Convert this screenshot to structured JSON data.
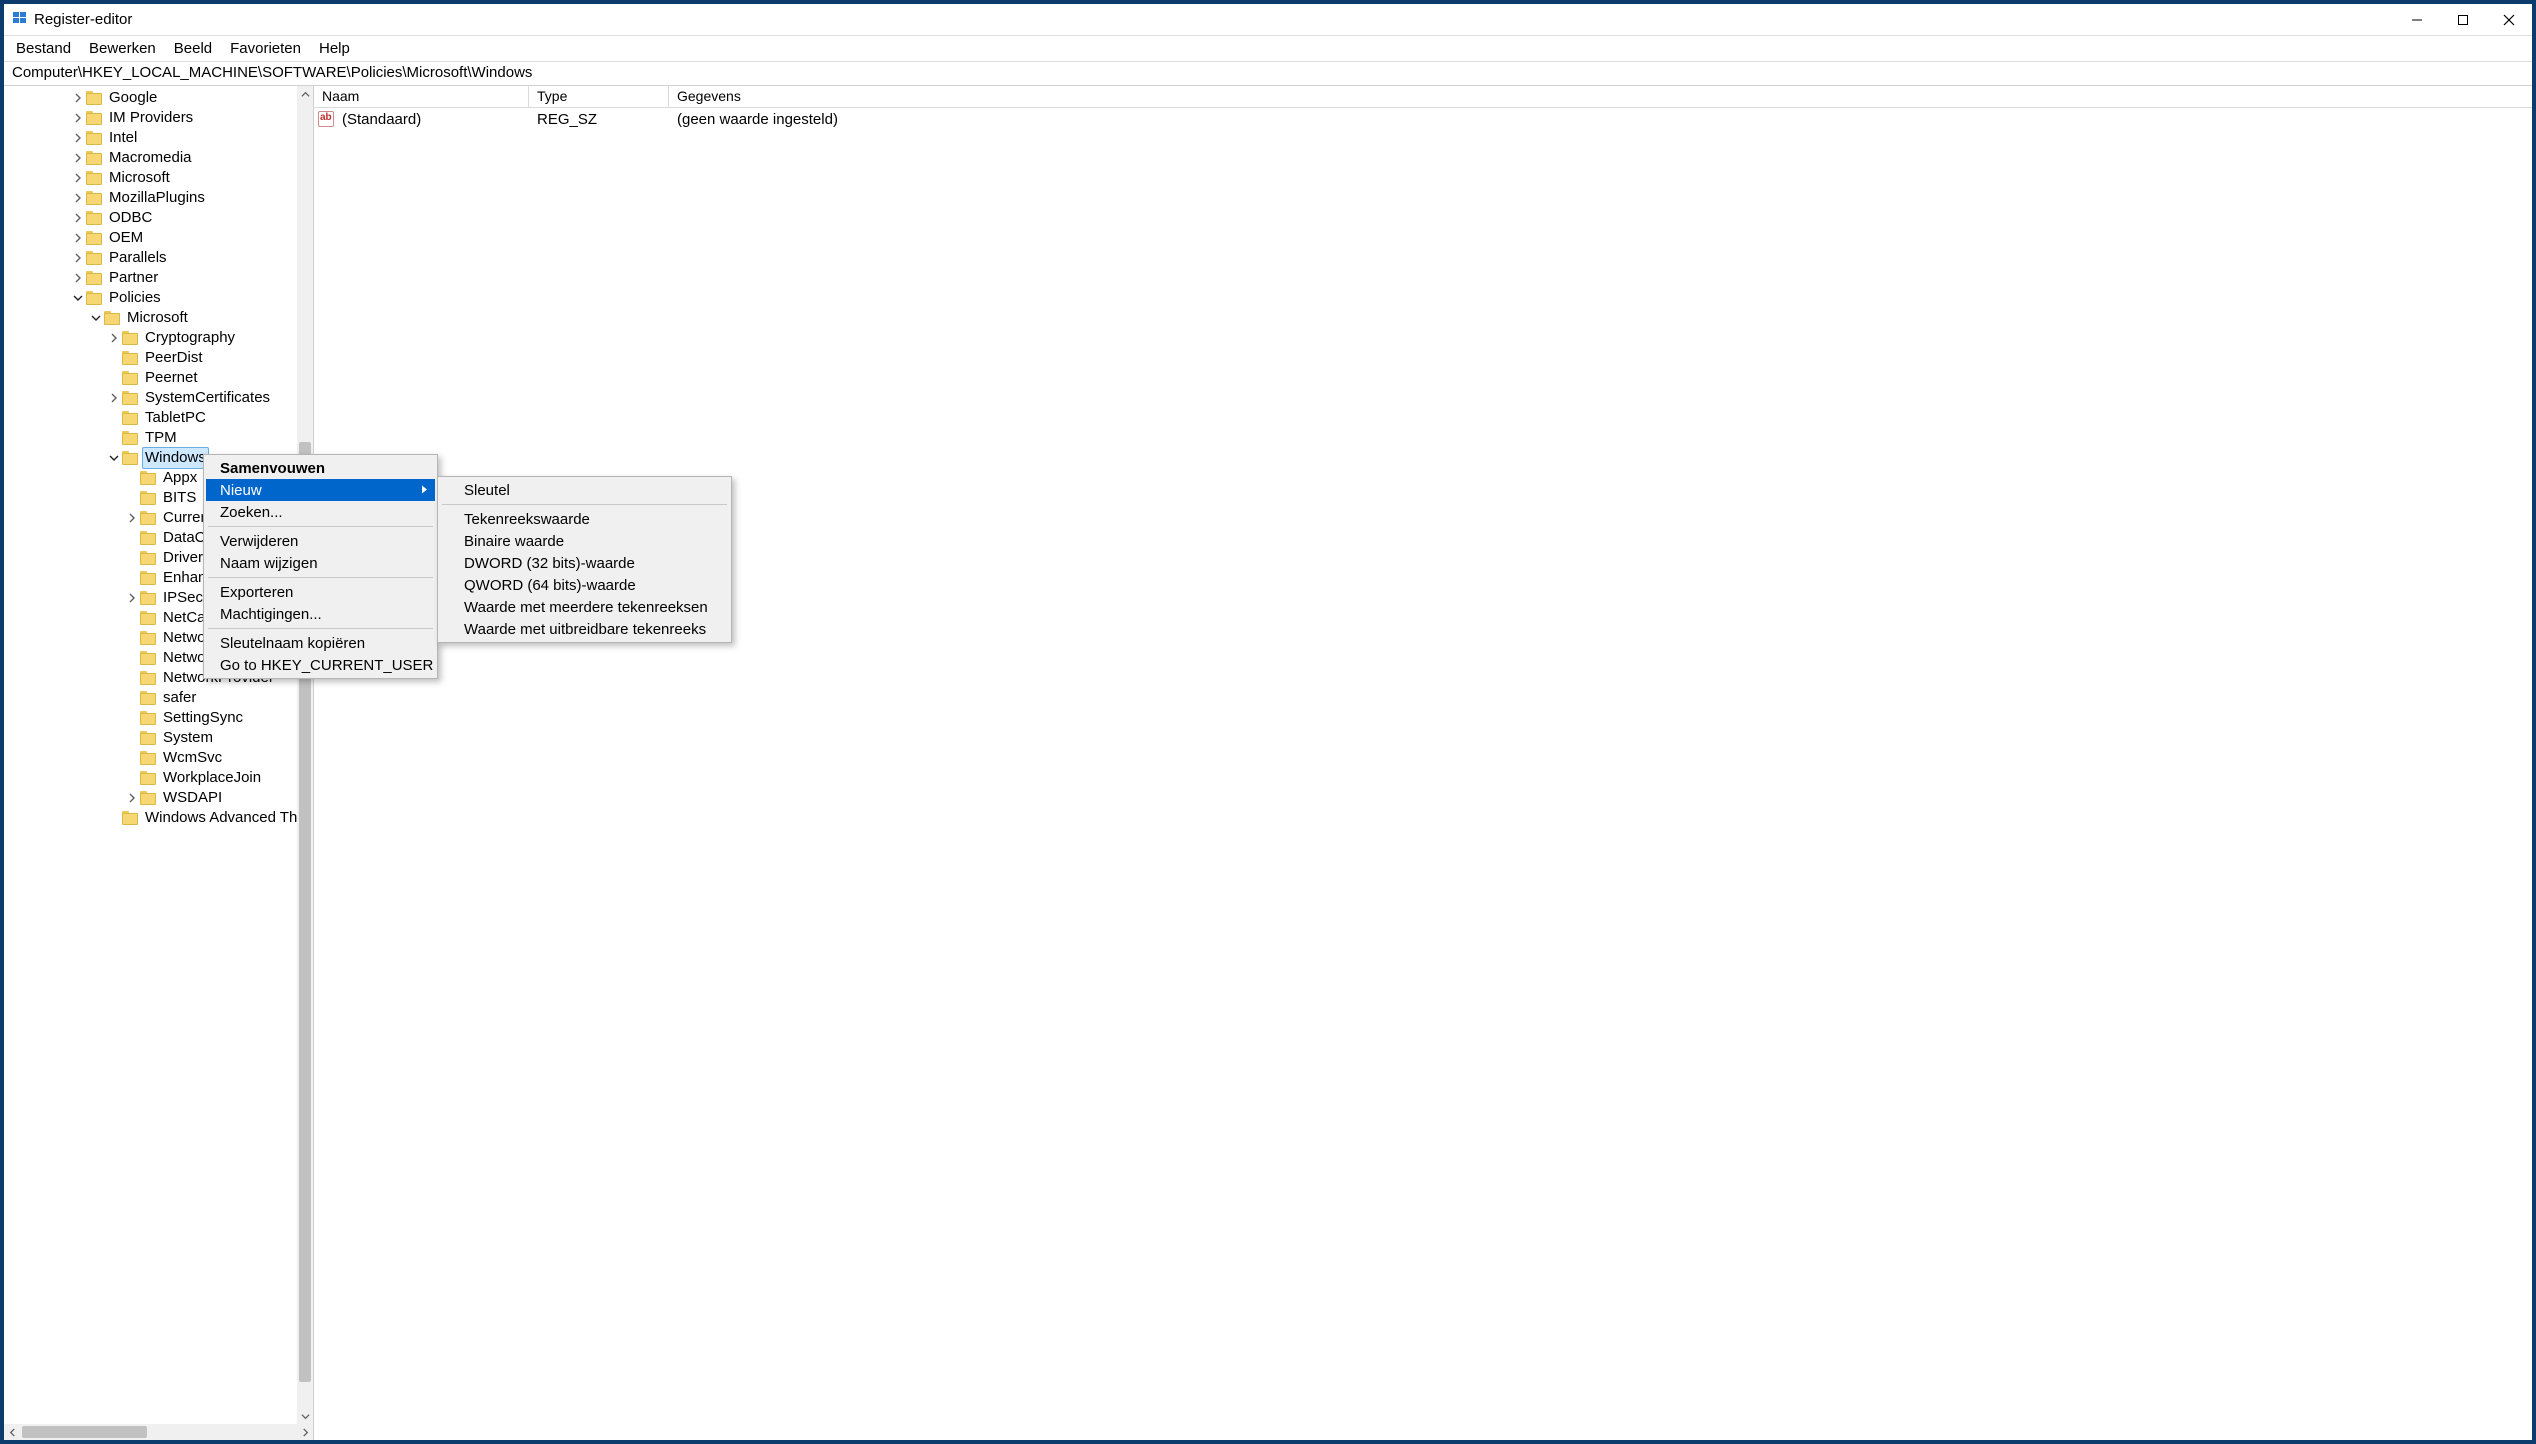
{
  "window": {
    "title": "Register-editor"
  },
  "menubar": {
    "items": [
      "Bestand",
      "Bewerken",
      "Beeld",
      "Favorieten",
      "Help"
    ]
  },
  "addressbar": {
    "path": "Computer\\HKEY_LOCAL_MACHINE\\SOFTWARE\\Policies\\Microsoft\\Windows"
  },
  "tree": {
    "nodes": [
      {
        "depth": 3,
        "chev": "right",
        "label": "Google"
      },
      {
        "depth": 3,
        "chev": "right",
        "label": "IM Providers"
      },
      {
        "depth": 3,
        "chev": "right",
        "label": "Intel"
      },
      {
        "depth": 3,
        "chev": "right",
        "label": "Macromedia"
      },
      {
        "depth": 3,
        "chev": "right",
        "label": "Microsoft"
      },
      {
        "depth": 3,
        "chev": "right",
        "label": "MozillaPlugins"
      },
      {
        "depth": 3,
        "chev": "right",
        "label": "ODBC"
      },
      {
        "depth": 3,
        "chev": "right",
        "label": "OEM"
      },
      {
        "depth": 3,
        "chev": "right",
        "label": "Parallels"
      },
      {
        "depth": 3,
        "chev": "right",
        "label": "Partner"
      },
      {
        "depth": 3,
        "chev": "down",
        "label": "Policies"
      },
      {
        "depth": 4,
        "chev": "down",
        "label": "Microsoft"
      },
      {
        "depth": 5,
        "chev": "right",
        "label": "Cryptography"
      },
      {
        "depth": 5,
        "chev": "none",
        "label": "PeerDist"
      },
      {
        "depth": 5,
        "chev": "none",
        "label": "Peernet"
      },
      {
        "depth": 5,
        "chev": "right",
        "label": "SystemCertificates"
      },
      {
        "depth": 5,
        "chev": "none",
        "label": "TabletPC"
      },
      {
        "depth": 5,
        "chev": "none",
        "label": "TPM"
      },
      {
        "depth": 5,
        "chev": "down",
        "label": "Windows",
        "selected": true
      },
      {
        "depth": 6,
        "chev": "none",
        "label": "Appx"
      },
      {
        "depth": 6,
        "chev": "none",
        "label": "BITS"
      },
      {
        "depth": 6,
        "chev": "right",
        "label": "CurrentVersion",
        "truncated": "Curren"
      },
      {
        "depth": 6,
        "chev": "none",
        "label": "DataCollection",
        "truncated": "DataC"
      },
      {
        "depth": 6,
        "chev": "none",
        "label": "DriverSearching",
        "truncated": "Driver"
      },
      {
        "depth": 6,
        "chev": "none",
        "label": "EnhancedStorageDevices",
        "truncated": "Enhan"
      },
      {
        "depth": 6,
        "chev": "right",
        "label": "IPSec"
      },
      {
        "depth": 6,
        "chev": "none",
        "label": "NetCache",
        "truncated": "NetCa"
      },
      {
        "depth": 6,
        "chev": "none",
        "label": "NetworkConnectivityStatusIndicator",
        "truncated": "Netwo"
      },
      {
        "depth": 6,
        "chev": "none",
        "label": "NetworkIsolation",
        "truncated": "Netwo"
      },
      {
        "depth": 6,
        "chev": "none",
        "label": "NetworkProvider",
        "truncated": "NetworkProvider"
      },
      {
        "depth": 6,
        "chev": "none",
        "label": "safer"
      },
      {
        "depth": 6,
        "chev": "none",
        "label": "SettingSync"
      },
      {
        "depth": 6,
        "chev": "none",
        "label": "System"
      },
      {
        "depth": 6,
        "chev": "none",
        "label": "WcmSvc"
      },
      {
        "depth": 6,
        "chev": "none",
        "label": "WorkplaceJoin"
      },
      {
        "depth": 6,
        "chev": "right",
        "label": "WSDAPI"
      },
      {
        "depth": 5,
        "chev": "none",
        "label": "Windows Advanced Threa"
      }
    ]
  },
  "values": {
    "columns": {
      "name": "Naam",
      "type": "Type",
      "data": "Gegevens"
    },
    "rows": [
      {
        "name": "(Standaard)",
        "type": "REG_SZ",
        "data": "(geen waarde ingesteld)"
      }
    ]
  },
  "context_menu": {
    "items": [
      {
        "label": "Samenvouwen",
        "bold": true
      },
      {
        "label": "Nieuw",
        "submenu": true,
        "hover": true
      },
      {
        "label": "Zoeken..."
      },
      {
        "sep": true
      },
      {
        "label": "Verwijderen"
      },
      {
        "label": "Naam wijzigen"
      },
      {
        "sep": true
      },
      {
        "label": "Exporteren"
      },
      {
        "label": "Machtigingen..."
      },
      {
        "sep": true
      },
      {
        "label": "Sleutelnaam kopiëren"
      },
      {
        "label": "Go to HKEY_CURRENT_USER"
      }
    ]
  },
  "submenu": {
    "items": [
      {
        "label": "Sleutel"
      },
      {
        "sep": true
      },
      {
        "label": "Tekenreekswaarde"
      },
      {
        "label": "Binaire waarde"
      },
      {
        "label": "DWORD (32 bits)-waarde"
      },
      {
        "label": "QWORD (64 bits)-waarde"
      },
      {
        "label": "Waarde met meerdere tekenreeksen"
      },
      {
        "label": "Waarde met uitbreidbare tekenreeks"
      }
    ]
  }
}
